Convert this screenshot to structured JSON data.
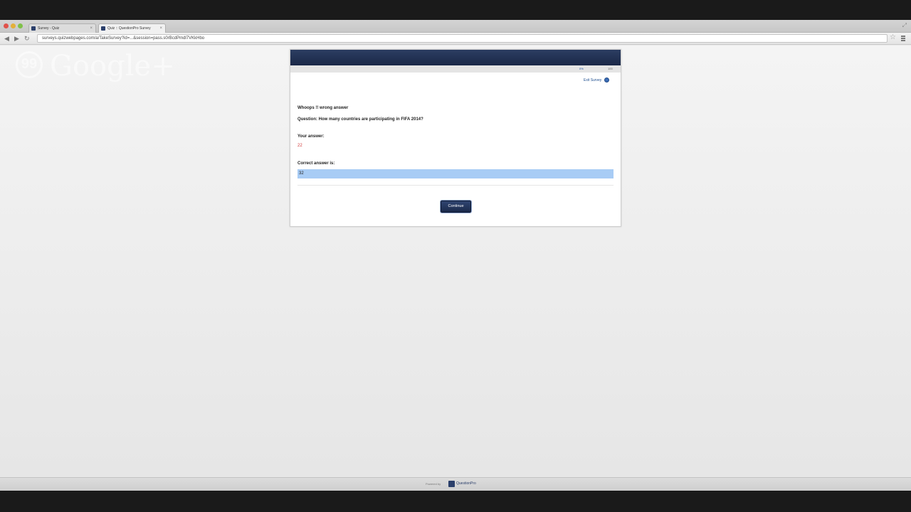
{
  "browser": {
    "tabs": [
      {
        "label": "Survey - Quiz"
      },
      {
        "label": "Quiz :: QuestionPro Survey"
      }
    ],
    "url": "surveys.quizwebpages.com/a/TakeSurvey?id=...&session=pass.s0rBcdPmdl7VKkHbo"
  },
  "overlay": {
    "brand": "Google+",
    "quote_glyph": "99"
  },
  "survey": {
    "progress_percent": 0,
    "progress_label_current": "0%",
    "progress_label_max": "100",
    "exit_label": "Exit Survey",
    "title": "Whoops !! wrong answer",
    "question": "Question: How many countries are participating in FIFA 2014?",
    "your_answer_label": "Your answer:",
    "your_answer": "22",
    "correct_label": "Correct answer is:",
    "correct_answer": "32",
    "continue_label": "Continue"
  },
  "footer": {
    "powered_by": "Powered by",
    "brand": "QuestionPro"
  }
}
